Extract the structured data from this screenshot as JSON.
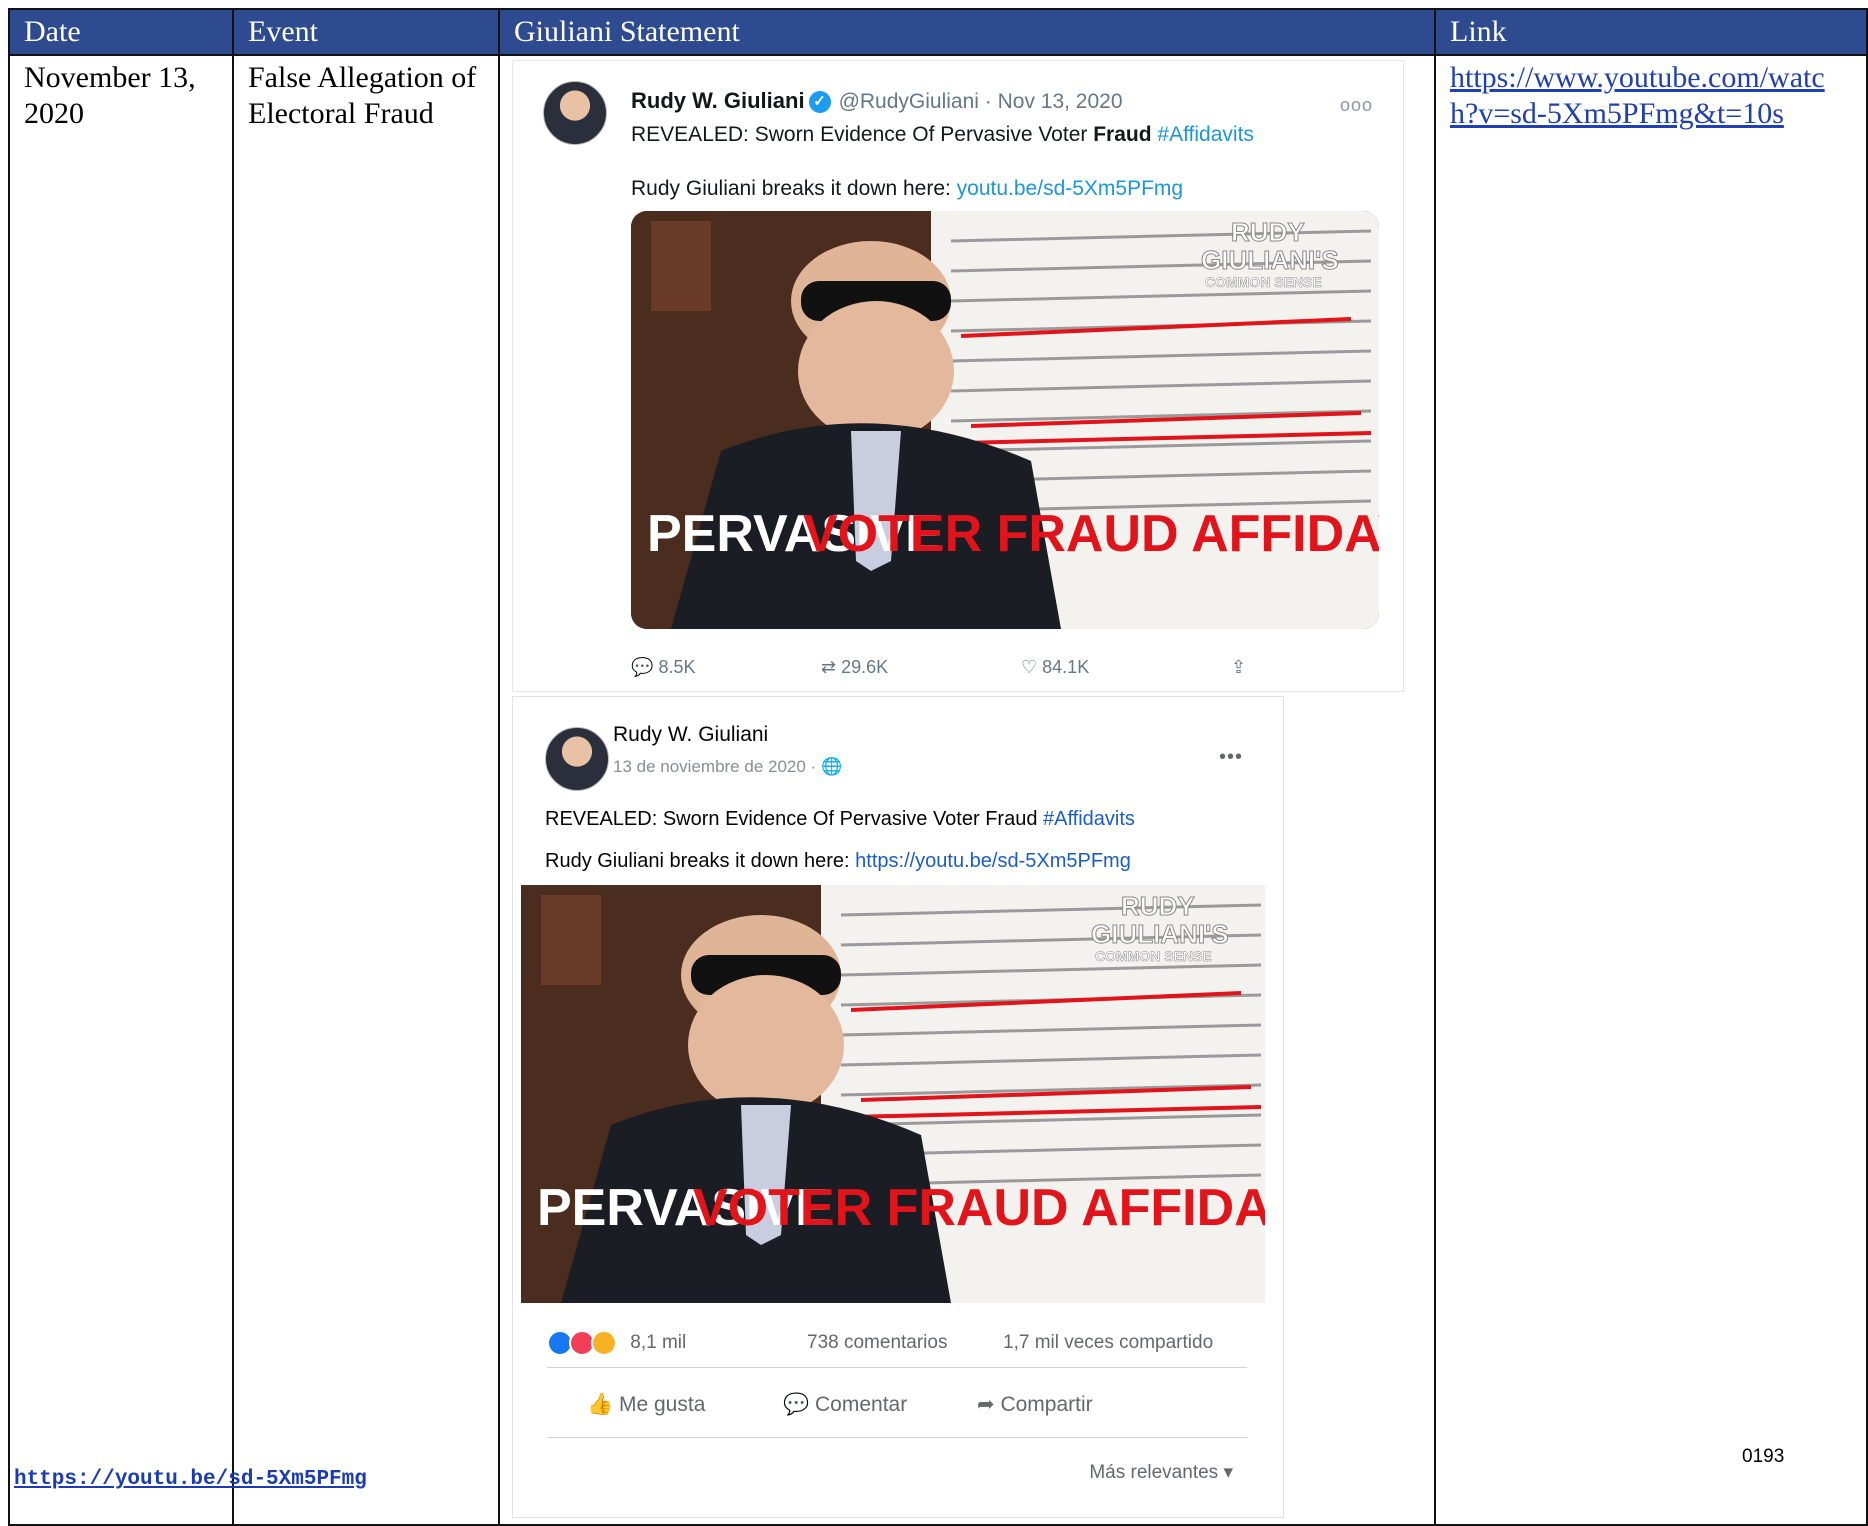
{
  "table": {
    "headers": [
      "Date",
      "Event",
      "Giuliani Statement",
      "Link"
    ],
    "row": {
      "date": "November 13, 2020",
      "event": "False Allegation of Electoral Fraud",
      "link": "https://www.youtube.com/watch?v=sd-5Xm5PFmg&t=10s"
    }
  },
  "tweet": {
    "name": "Rudy W. Giuliani",
    "handle": "@RudyGiuliani · Nov 13, 2020",
    "more": "ooo",
    "text_before": "REVEALED: Sworn Evidence Of Pervasive Voter ",
    "text_bold": "Fraud",
    "hashtag": "#Affidavits",
    "text2": "Rudy Giuliani breaks it down here: ",
    "link": "youtu.be/sd-5Xm5PFmg",
    "replies": "8.5K",
    "retweets": "29.6K",
    "likes": "84.1K"
  },
  "thumbnail": {
    "caption_white": "PERVASIVE",
    "caption_red": "VOTER FRAUD AFFIDAVITS",
    "logo_line1": "RUDY",
    "logo_line2": "GIULIANI'S",
    "logo_line3": "COMMON SENSE"
  },
  "facebook": {
    "name": "Rudy W. Giuliani",
    "date": "13 de noviembre de 2020 ·",
    "more": "•••",
    "text": "REVEALED: Sworn Evidence Of Pervasive Voter Fraud ",
    "hashtag": "#Affidavits",
    "text2": "Rudy Giuliani breaks it down here: ",
    "link": "https://youtu.be/sd-5Xm5PFmg",
    "reactions": "8,1 mil",
    "comments": "738 comentarios",
    "shares": "1,7 mil veces compartido",
    "like_btn": "Me gusta",
    "comment_btn": "Comentar",
    "share_btn": "Compartir",
    "sort": "Más relevantes"
  },
  "bottom_link": "https://youtu.be/sd-5Xm5PFmg",
  "page_number": "0193",
  "colors": {
    "header_bg": "#2e4b8f",
    "twitter_blue": "#1b95e0",
    "facebook_blue": "#1a5ccf",
    "caption_red": "#e0141a"
  }
}
